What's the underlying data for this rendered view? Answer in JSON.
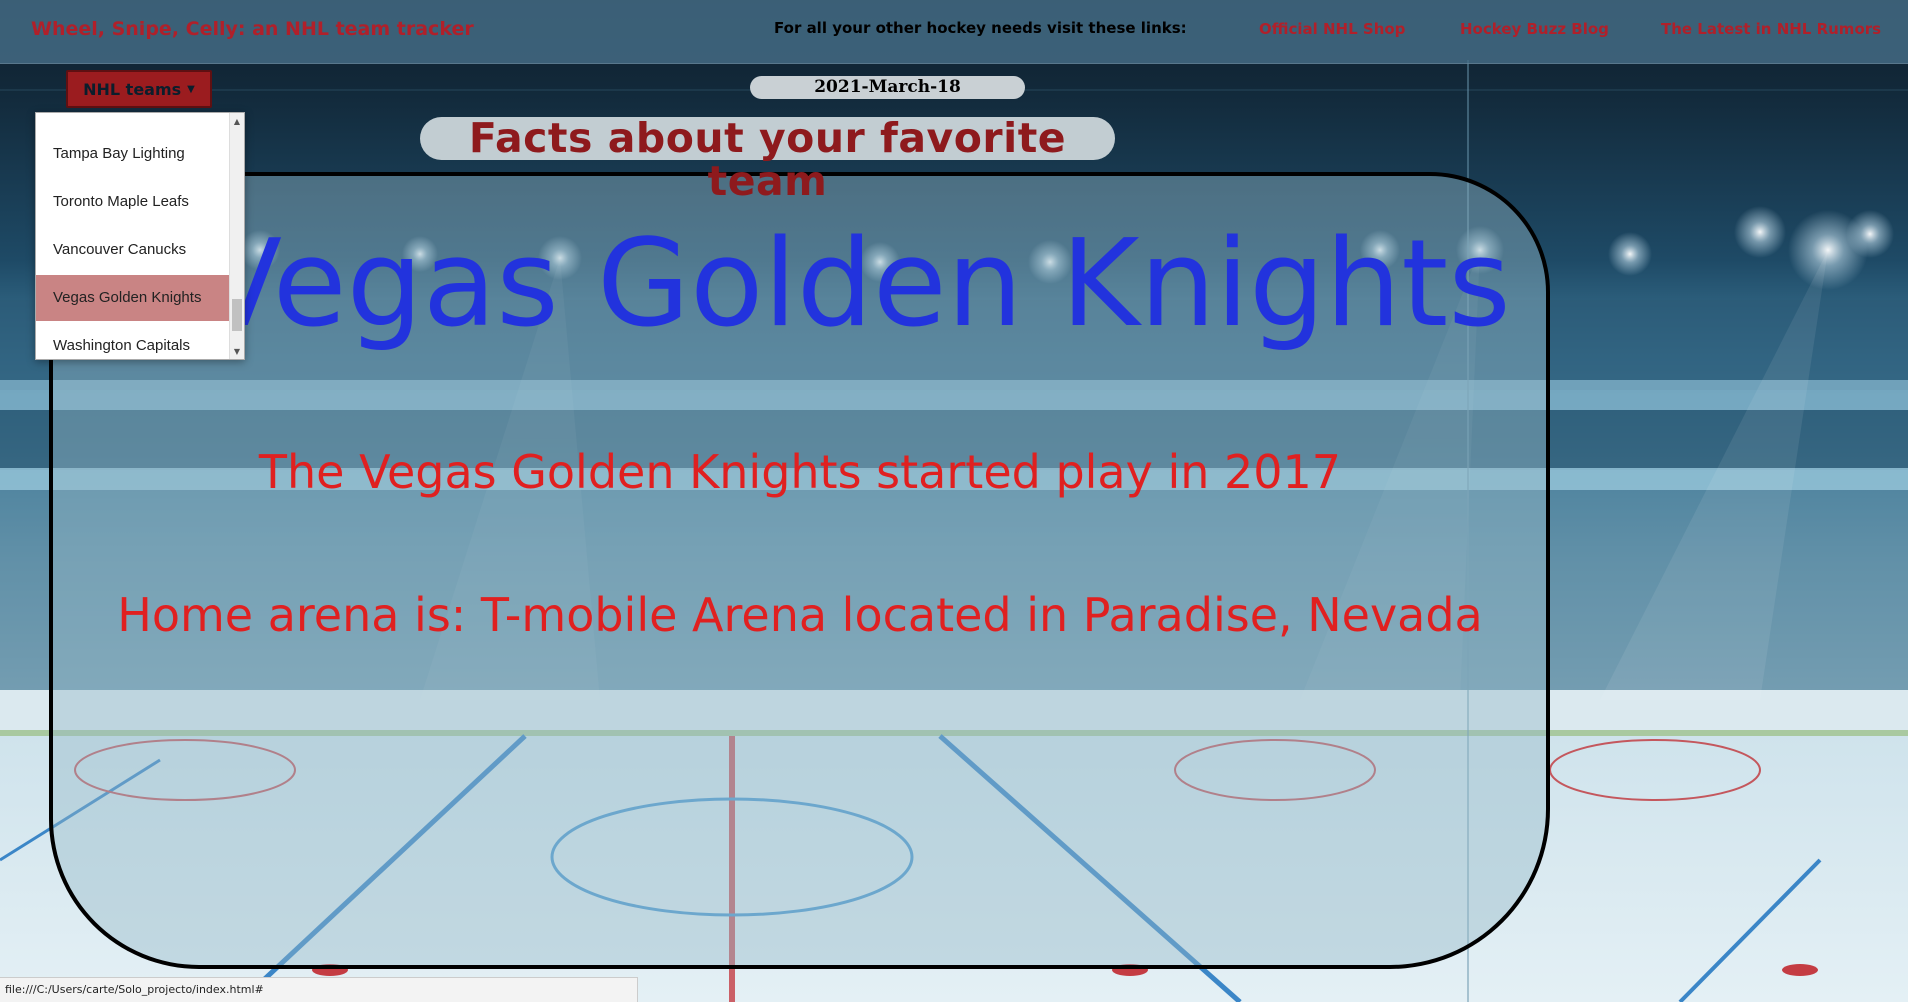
{
  "navbar": {
    "brand": "Wheel, Snipe, Celly: an NHL team tracker",
    "tagline": "For all your other hockey needs visit these links:",
    "links": [
      "Official NHL Shop",
      "Hockey Buzz Blog",
      "The Latest in NHL Rumors"
    ]
  },
  "dropdown": {
    "button_label": "NHL teams",
    "items": [
      "Tampa Bay Lighting",
      "Toronto Maple Leafs",
      "Vancouver Canucks",
      "Vegas Golden Knights",
      "Washington Capitals"
    ],
    "selected": "Vegas Golden Knights"
  },
  "date": "2021-March-18",
  "facts_heading": "Facts about your favorite team",
  "team": {
    "name": "Vegas Golden Knights",
    "started": "The Vegas Golden Knights started play in 2017",
    "arena": "Home arena is: T-mobile Arena located in Paradise, Nevada"
  },
  "status_url": "file:///C:/Users/carte/Solo_projecto/index.html#",
  "colors": {
    "brand_red": "#b0202a",
    "team_blue": "#2233dd",
    "fact_red": "#e02020",
    "heading_red": "#8e1a1d",
    "selected_item": "#c98484"
  }
}
